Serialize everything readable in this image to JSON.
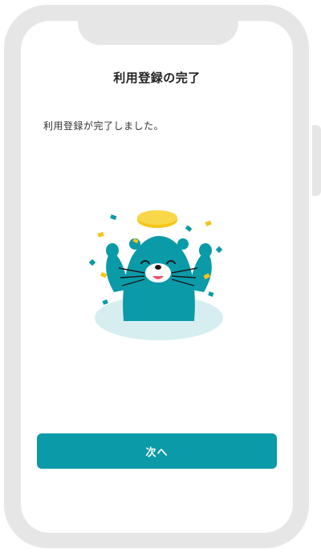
{
  "page": {
    "title": "利用登録の完了",
    "message": "利用登録が完了しました。"
  },
  "illustration": {
    "icon": "celebrating-otter-icon"
  },
  "actions": {
    "next_label": "次へ"
  },
  "colors": {
    "frame": "#e6e6e6",
    "accent": "#0b9aa8",
    "coin": "#f5c518",
    "puddle": "#d6eef0"
  }
}
